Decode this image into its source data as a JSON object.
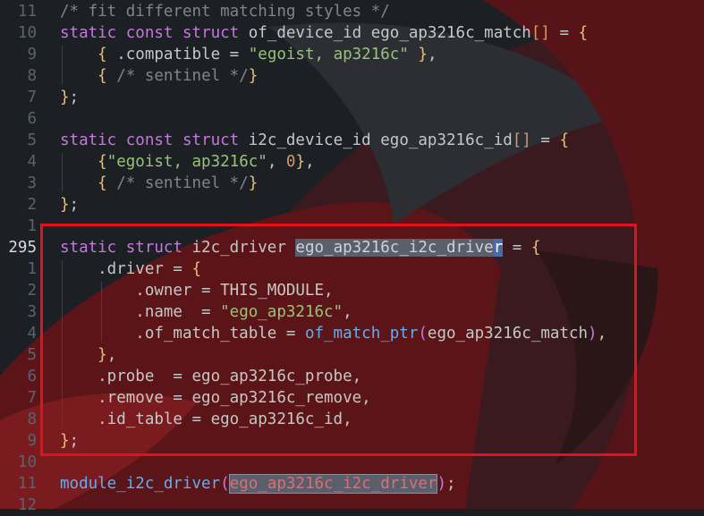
{
  "highlight_color": "#e4111c",
  "lines": [
    {
      "num": "11",
      "tokens": [
        [
          "cmt",
          "/* fit different matching styles */"
        ]
      ]
    },
    {
      "num": "10",
      "tokens": [
        [
          "kw",
          "static"
        ],
        [
          "plain",
          " "
        ],
        [
          "kw",
          "const"
        ],
        [
          "plain",
          " "
        ],
        [
          "kw",
          "struct"
        ],
        [
          "plain",
          " of_device_id ego_ap3216c_match"
        ],
        [
          "num",
          "[]"
        ],
        [
          "plain",
          " = "
        ],
        [
          "brace",
          "{"
        ]
      ]
    },
    {
      "num": "9",
      "tokens": [
        [
          "plain",
          "    "
        ],
        [
          "brace",
          "{"
        ],
        [
          "plain",
          " .compatible = "
        ],
        [
          "str",
          "\"egoist, ap3216c\""
        ],
        [
          "plain",
          " "
        ],
        [
          "brace",
          "}"
        ],
        [
          "plain",
          ","
        ]
      ]
    },
    {
      "num": "8",
      "tokens": [
        [
          "plain",
          "    "
        ],
        [
          "brace",
          "{"
        ],
        [
          "plain",
          " "
        ],
        [
          "cmt",
          "/* sentinel */"
        ],
        [
          "brace",
          "}"
        ]
      ]
    },
    {
      "num": "7",
      "tokens": [
        [
          "brace",
          "}"
        ],
        [
          "plain",
          ";"
        ]
      ]
    },
    {
      "num": "6",
      "tokens": []
    },
    {
      "num": "5",
      "tokens": [
        [
          "kw",
          "static"
        ],
        [
          "plain",
          " "
        ],
        [
          "kw",
          "const"
        ],
        [
          "plain",
          " "
        ],
        [
          "kw",
          "struct"
        ],
        [
          "plain",
          " i2c_device_id ego_ap3216c_id"
        ],
        [
          "num",
          "[]"
        ],
        [
          "plain",
          " = "
        ],
        [
          "brace",
          "{"
        ]
      ]
    },
    {
      "num": "4",
      "tokens": [
        [
          "plain",
          "    "
        ],
        [
          "brace",
          "{"
        ],
        [
          "str",
          "\"egoist, ap3216c\""
        ],
        [
          "plain",
          ", "
        ],
        [
          "num",
          "0"
        ],
        [
          "brace",
          "}"
        ],
        [
          "plain",
          ","
        ]
      ]
    },
    {
      "num": "3",
      "tokens": [
        [
          "plain",
          "    "
        ],
        [
          "brace",
          "{"
        ],
        [
          "plain",
          " "
        ],
        [
          "cmt",
          "/* sentinel */"
        ],
        [
          "brace",
          "}"
        ]
      ]
    },
    {
      "num": "2",
      "tokens": [
        [
          "brace",
          "}"
        ],
        [
          "plain",
          ";"
        ]
      ]
    },
    {
      "num": "1",
      "tokens": []
    },
    {
      "num": "295",
      "current": true,
      "tokens": [
        [
          "kw",
          "static"
        ],
        [
          "plain",
          " "
        ],
        [
          "kw",
          "struct"
        ],
        [
          "plain",
          " i2c_driver "
        ],
        [
          "sel",
          "ego_ap3216c_i2c_drive"
        ],
        [
          "cursor",
          "r"
        ],
        [
          "plain",
          " = "
        ],
        [
          "brace",
          "{"
        ]
      ]
    },
    {
      "num": "1",
      "tokens": [
        [
          "plain",
          "    .driver = "
        ],
        [
          "brace",
          "{"
        ]
      ]
    },
    {
      "num": "2",
      "tokens": [
        [
          "plain",
          "        .owner = THIS_MODULE,"
        ]
      ]
    },
    {
      "num": "3",
      "tokens": [
        [
          "plain",
          "        .name  = "
        ],
        [
          "str",
          "\"ego_ap3216c\""
        ],
        [
          "plain",
          ","
        ]
      ]
    },
    {
      "num": "4",
      "tokens": [
        [
          "plain",
          "        .of_match_table = "
        ],
        [
          "fn",
          "of_match_ptr"
        ],
        [
          "paren",
          "("
        ],
        [
          "plain",
          "ego_ap3216c_match"
        ],
        [
          "paren",
          ")"
        ],
        [
          "plain",
          ","
        ]
      ]
    },
    {
      "num": "5",
      "tokens": [
        [
          "plain",
          "    "
        ],
        [
          "brace",
          "}"
        ],
        [
          "plain",
          ","
        ]
      ]
    },
    {
      "num": "6",
      "tokens": [
        [
          "plain",
          "    .probe  = ego_ap3216c_probe,"
        ]
      ]
    },
    {
      "num": "7",
      "tokens": [
        [
          "plain",
          "    .remove = ego_ap3216c_remove,"
        ]
      ]
    },
    {
      "num": "8",
      "tokens": [
        [
          "plain",
          "    .id_table = ego_ap3216c_id,"
        ]
      ]
    },
    {
      "num": "9",
      "tokens": [
        [
          "brace",
          "}"
        ],
        [
          "plain",
          ";"
        ]
      ]
    },
    {
      "num": "10",
      "tokens": []
    },
    {
      "num": "11",
      "tokens": [
        [
          "fn",
          "module_i2c_driver"
        ],
        [
          "paren",
          "("
        ],
        [
          "sel2",
          "ego_ap3216c_i2c_driver"
        ],
        [
          "paren",
          ")"
        ],
        [
          "plain",
          ";"
        ]
      ]
    },
    {
      "num": "12",
      "tokens": []
    }
  ]
}
